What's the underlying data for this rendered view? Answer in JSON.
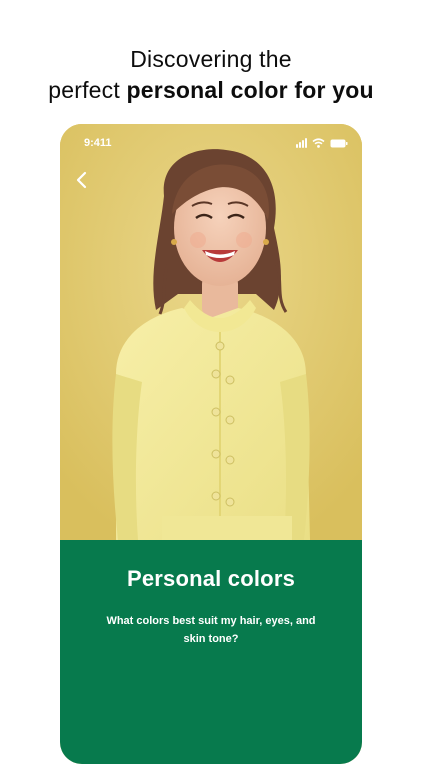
{
  "headline": {
    "line1": "Discovering the",
    "line2_regular": "perfect ",
    "line2_bold": "personal color for you"
  },
  "status_bar": {
    "time": "9:411",
    "icons": [
      "signal-icon",
      "wifi-icon",
      "battery-icon"
    ]
  },
  "nav": {
    "back_icon": "chevron-left-icon"
  },
  "hero": {
    "background_color": "#e2cb6c",
    "subject": "smiling woman in pale yellow blouse"
  },
  "panel": {
    "title": "Personal colors",
    "subtitle": "What colors best suit my hair, eyes, and skin tone?",
    "background_color": "#077a4d"
  },
  "colors": {
    "accent_green": "#077a4d",
    "hero_yellow": "#e2cb6c",
    "text_dark": "#0d0d0d"
  }
}
